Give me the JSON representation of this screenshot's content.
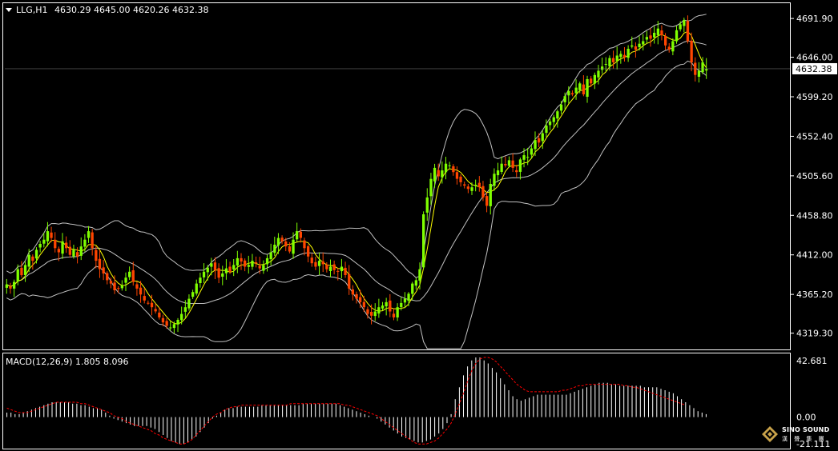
{
  "header": {
    "symbol_label": "LLG,H1",
    "ohlc_text": "4630.29 4645.00 4620.26 4632.38"
  },
  "price_axis": {
    "labels": [
      "4691.90",
      "4646.00",
      "4599.20",
      "4552.40",
      "4505.60",
      "4458.80",
      "4412.00",
      "4365.20",
      "4319.30"
    ],
    "current_price_label": "4632.38"
  },
  "macd_panel": {
    "label": "MACD(12,26,9) 1.805 8.096",
    "axis_labels": [
      "42.681",
      "0.00",
      "-21.111"
    ]
  },
  "watermark": {
    "brand": "SINO SOUND",
    "sub": "漢 聲 集 團"
  },
  "colors": {
    "background": "#000000",
    "bull_candle": "#7fff00",
    "bear_candle": "#ff4500",
    "ma_line": "#ffff00",
    "bollinger": "#c0c0c0",
    "macd_hist": "#ffffff",
    "macd_signal": "#ff0000",
    "panel_border": "#ffffff"
  },
  "chart_data": {
    "type": "candlestick",
    "symbol": "LLG",
    "timeframe": "H1",
    "last": {
      "open": 4630.29,
      "high": 4645.0,
      "low": 4620.26,
      "close": 4632.38
    },
    "y_range": [
      4300,
      4710
    ],
    "closes": [
      4377,
      4372,
      4380,
      4395,
      4388,
      4400,
      4412,
      4405,
      4418,
      4425,
      4430,
      4440,
      4432,
      4420,
      4415,
      4428,
      4420,
      4412,
      4418,
      4410,
      4422,
      4430,
      4440,
      4420,
      4405,
      4395,
      4390,
      4382,
      4378,
      4370,
      4372,
      4376,
      4385,
      4392,
      4380,
      4372,
      4365,
      4358,
      4355,
      4350,
      4345,
      4338,
      4332,
      4328,
      4326,
      4330,
      4335,
      4342,
      4350,
      4360,
      4368,
      4378,
      4385,
      4392,
      4397,
      4402,
      4394,
      4385,
      4390,
      4396,
      4392,
      4400,
      4408,
      4404,
      4398,
      4400,
      4405,
      4402,
      4396,
      4400,
      4408,
      4415,
      4424,
      4432,
      4428,
      4422,
      4416,
      4430,
      4440,
      4432,
      4420,
      4410,
      4402,
      4398,
      4405,
      4401,
      4395,
      4398,
      4394,
      4392,
      4398,
      4388,
      4372,
      4365,
      4360,
      4356,
      4350,
      4342,
      4340,
      4345,
      4350,
      4352,
      4356,
      4345,
      4338,
      4350,
      4355,
      4360,
      4366,
      4378,
      4382,
      4395,
      4460,
      4480,
      4502,
      4515,
      4505,
      4512,
      4520,
      4518,
      4510,
      4502,
      4498,
      4494,
      4490,
      4492,
      4495,
      4492,
      4480,
      4470,
      4496,
      4508,
      4512,
      4520,
      4518,
      4524,
      4515,
      4510,
      4525,
      4530,
      4528,
      4538,
      4548,
      4545,
      4556,
      4565,
      4570,
      4575,
      4582,
      4590,
      4600,
      4606,
      4602,
      4610,
      4615,
      4602,
      4620,
      4615,
      4625,
      4630,
      4635,
      4638,
      4645,
      4640,
      4648,
      4650,
      4646,
      4656,
      4660,
      4655,
      4662,
      4665,
      4670,
      4668,
      4675,
      4680,
      4672,
      4660,
      4655,
      4665,
      4678,
      4685,
      4690,
      4665,
      4640,
      4625,
      4630,
      4640,
      4632
    ],
    "macd_range": [
      -21.111,
      42.681
    ],
    "macd_hist": [
      3,
      3,
      2,
      2,
      3,
      4,
      5,
      6,
      7,
      8,
      9,
      10,
      10,
      10,
      10,
      10,
      9,
      9,
      8,
      8,
      7,
      6,
      6,
      5,
      3,
      1,
      -1,
      -2,
      -3,
      -4,
      -5,
      -6,
      -6,
      -6,
      -6,
      -7,
      -8,
      -10,
      -12,
      -14,
      -16,
      -17,
      -18,
      -18,
      -17,
      -15,
      -13,
      -10,
      -7,
      -4,
      -1,
      1,
      3,
      5,
      6,
      6,
      7,
      7,
      7,
      7,
      7,
      7,
      8,
      8,
      8,
      8,
      8,
      8,
      8,
      8,
      8,
      8,
      9,
      9,
      9,
      9,
      9,
      9,
      9,
      9,
      9,
      8,
      7,
      6,
      5,
      4,
      3,
      2,
      1,
      0,
      -1,
      -3,
      -5,
      -7,
      -9,
      -11,
      -13,
      -14,
      -15,
      -16,
      -17,
      -17,
      -16,
      -15,
      -13,
      -11,
      -8,
      -4,
      2,
      12,
      20,
      28,
      34,
      38,
      40,
      40,
      38,
      36,
      33,
      30,
      26,
      22,
      18,
      14,
      12,
      11,
      12,
      13,
      14,
      15,
      15,
      15,
      15,
      15,
      15,
      15,
      15,
      16,
      17,
      18,
      19,
      20,
      21,
      22,
      23,
      23,
      23,
      22,
      22,
      21,
      21,
      21,
      21,
      21,
      21,
      20,
      20,
      20,
      20,
      19,
      18,
      17,
      16,
      14,
      12,
      10,
      8,
      6,
      4,
      3,
      2
    ],
    "macd_signal": [
      6,
      5,
      4,
      3,
      3,
      3,
      4,
      5,
      6,
      7,
      8,
      9,
      10,
      10,
      10,
      10,
      10,
      10,
      9,
      9,
      8,
      7,
      6,
      5,
      4,
      3,
      1,
      0,
      -1,
      -3,
      -4,
      -5,
      -6,
      -7,
      -8,
      -9,
      -11,
      -12,
      -14,
      -15,
      -16,
      -17,
      -18,
      -18,
      -17,
      -15,
      -12,
      -9,
      -6,
      -3,
      0,
      2,
      3,
      5,
      6,
      7,
      7,
      8,
      8,
      8,
      8,
      8,
      8,
      8,
      8,
      8,
      8,
      8,
      8,
      9,
      9,
      9,
      9,
      9,
      9,
      9,
      9,
      9,
      9,
      9,
      9,
      9,
      8,
      8,
      7,
      6,
      5,
      4,
      3,
      2,
      1,
      -1,
      -3,
      -5,
      -7,
      -9,
      -11,
      -13,
      -15,
      -17,
      -18,
      -18,
      -18,
      -17,
      -16,
      -14,
      -11,
      -8,
      -4,
      2,
      9,
      16,
      24,
      31,
      36,
      39,
      40,
      40,
      39,
      37,
      34,
      31,
      28,
      25,
      22,
      20,
      18,
      17,
      17,
      17,
      17,
      17,
      17,
      17,
      17,
      18,
      18,
      19,
      20,
      21,
      21,
      22,
      22,
      22,
      22,
      22,
      22,
      22,
      22,
      22,
      21,
      21,
      20,
      20,
      19,
      18,
      17,
      16,
      15,
      14,
      13,
      12,
      11,
      10,
      9,
      8
    ]
  }
}
